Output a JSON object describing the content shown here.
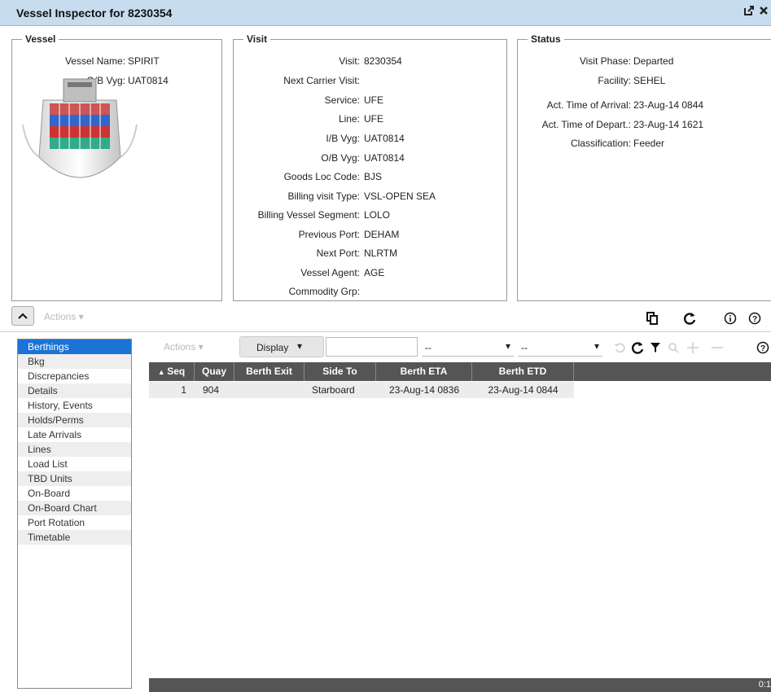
{
  "window": {
    "title": "Vessel Inspector for 8230354"
  },
  "vessel": {
    "legend": "Vessel",
    "rows": [
      {
        "label": "Vessel Name:",
        "value": "SPIRIT"
      },
      {
        "label": "O/B Vyg:",
        "value": "UAT0814"
      }
    ]
  },
  "visit": {
    "legend": "Visit",
    "rows": [
      {
        "label": "Visit:",
        "value": "8230354"
      },
      {
        "label": "Next Carrier Visit:",
        "value": ""
      },
      {
        "label": "Service:",
        "value": "UFE"
      },
      {
        "label": "Line:",
        "value": "UFE"
      },
      {
        "label": "I/B Vyg:",
        "value": "UAT0814"
      },
      {
        "label": "O/B Vyg:",
        "value": "UAT0814"
      },
      {
        "label": "Goods Loc Code:",
        "value": "BJS"
      },
      {
        "label": "Billing visit Type:",
        "value": "VSL-OPEN SEA"
      },
      {
        "label": "Billing Vessel Segment:",
        "value": "LOLO"
      },
      {
        "label": "Previous Port:",
        "value": "DEHAM"
      },
      {
        "label": "Next Port:",
        "value": "NLRTM"
      },
      {
        "label": "Vessel Agent:",
        "value": "AGE"
      },
      {
        "label": "Commodity Grp:",
        "value": ""
      }
    ]
  },
  "status": {
    "legend": "Status",
    "rows": [
      {
        "label": "Visit Phase:",
        "value": "Departed"
      },
      {
        "label": "Facility:",
        "value": "SEHEL"
      },
      {
        "label": "Act. Time of Arrival:",
        "value": "23-Aug-14 0844"
      },
      {
        "label": "Act. Time of Depart.:",
        "value": "23-Aug-14 1621"
      },
      {
        "label": "Classification:",
        "value": "Feeder"
      }
    ]
  },
  "toolbar": {
    "actions_label": "Actions"
  },
  "nav": {
    "items": [
      "Berthings",
      "Bkg",
      "Discrepancies",
      "Details",
      "History, Events",
      "Holds/Perms",
      "Late Arrivals",
      "Lines",
      "Load List",
      "TBD Units",
      "On-Board",
      "On-Board Chart",
      "Port Rotation",
      "Timetable"
    ],
    "selected": "Berthings"
  },
  "grid_toolbar": {
    "actions_label": "Actions",
    "display_label": "Display",
    "search_value": "",
    "filter1_value": "--",
    "filter2_value": "--"
  },
  "grid": {
    "columns": [
      "Seq",
      "Quay",
      "Berth Exit",
      "Side To",
      "Berth ETA",
      "Berth ETD"
    ],
    "rows": [
      [
        "1",
        "904",
        "",
        "Starboard",
        "23-Aug-14 0836",
        "23-Aug-14 0844"
      ]
    ],
    "footer": "0:1"
  },
  "colors": {
    "selected": "#1c73d6",
    "header": "#555555",
    "titlebar": "#c8dcef"
  }
}
